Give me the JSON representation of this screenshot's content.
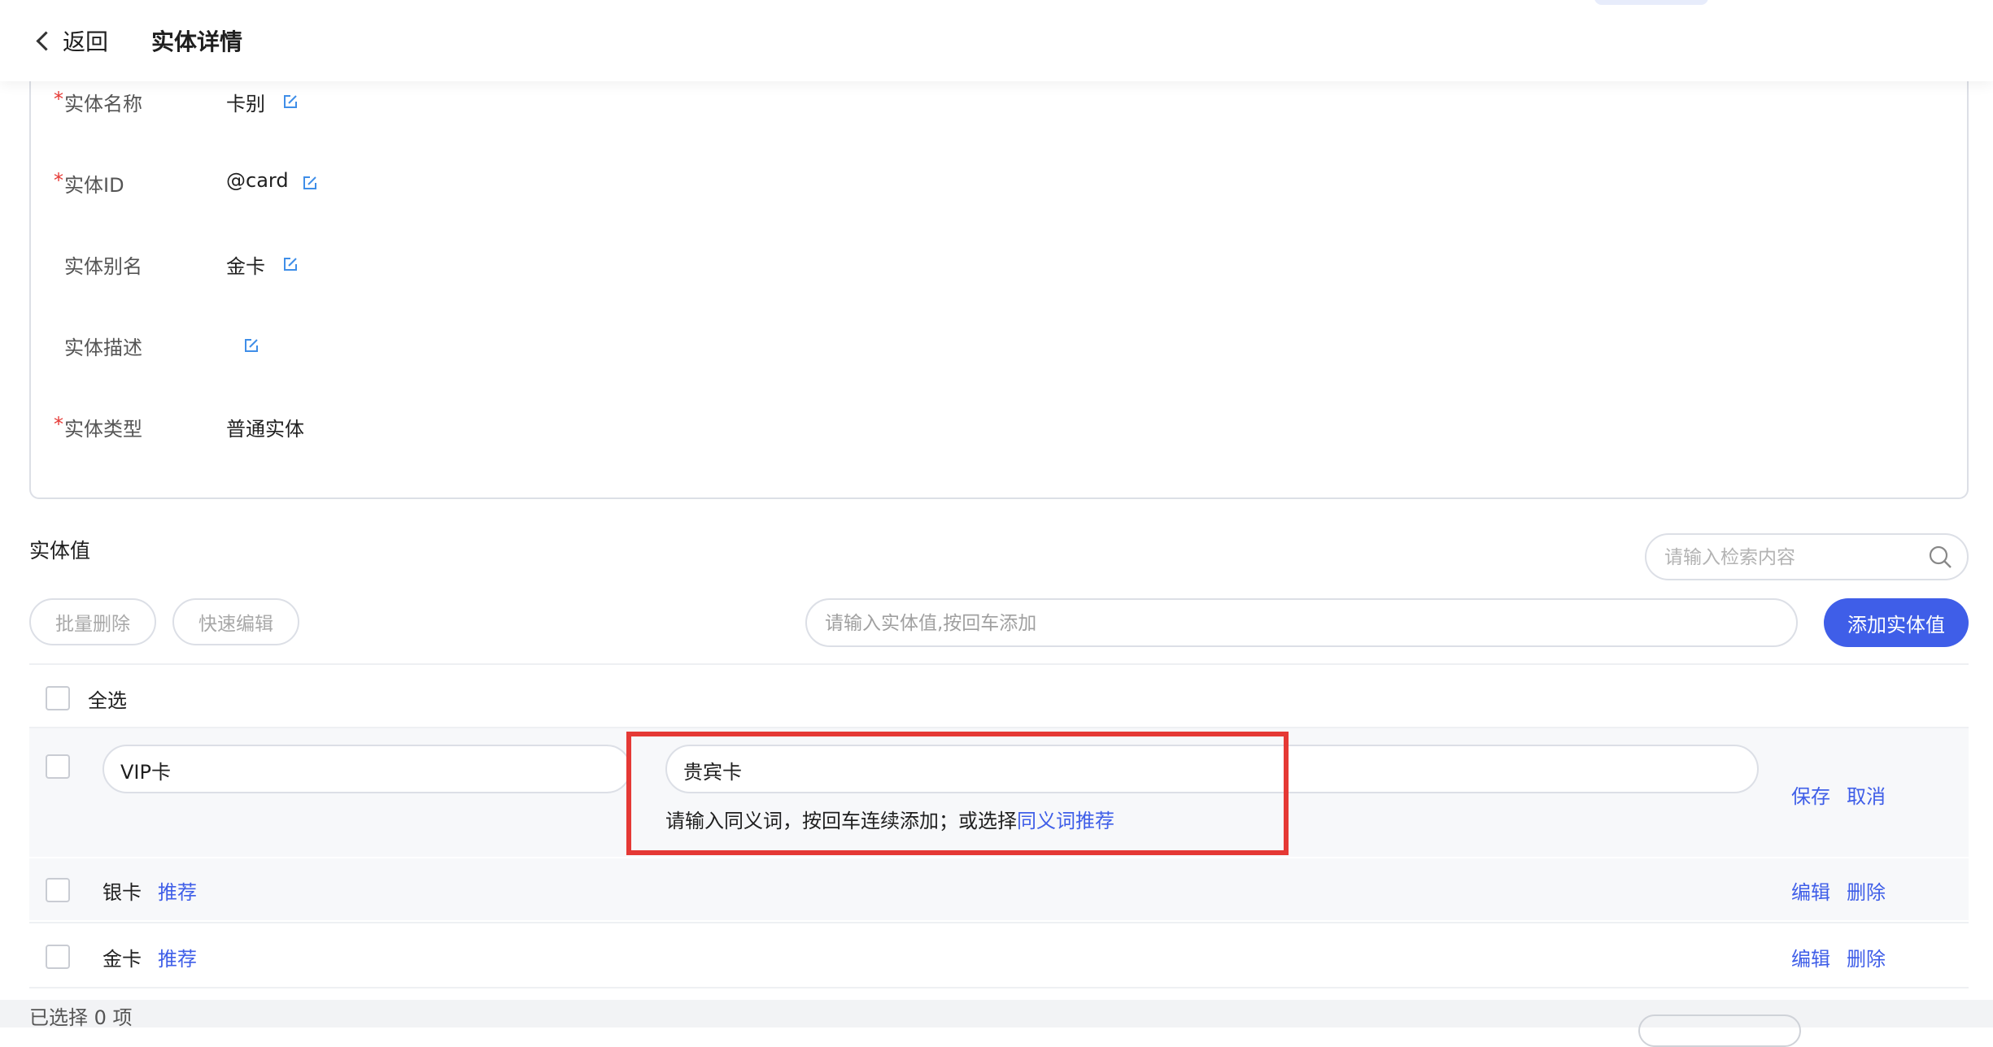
{
  "header": {
    "back_label": "返回",
    "title": "实体详情"
  },
  "info": {
    "name_label": "实体名称",
    "name_value": "卡别",
    "id_label": "实体ID",
    "id_value": "@card",
    "alias_label": "实体别名",
    "alias_value": "金卡",
    "desc_label": "实体描述",
    "desc_value": "",
    "type_label": "实体类型",
    "type_value": "普通实体",
    "required_mark": "*"
  },
  "values_section": {
    "title": "实体值",
    "search_placeholder": "请输入检索内容",
    "batch_delete": "批量删除",
    "quick_edit": "快速编辑",
    "add_placeholder": "请输入实体值,按回车添加",
    "add_button": "添加实体值",
    "select_all": "全选",
    "editing_row": {
      "value": "VIP卡",
      "synonym_value": "贵宾卡",
      "hint_text": "请输入同义词，按回车连续添加；或选择",
      "hint_link": "同义词推荐",
      "save": "保存",
      "cancel": "取消"
    },
    "rows": [
      {
        "value": "银卡",
        "tag": "推荐",
        "edit": "编辑",
        "delete": "删除"
      },
      {
        "value": "金卡",
        "tag": "推荐",
        "edit": "编辑",
        "delete": "删除"
      }
    ],
    "selected_count": "已选择 0 项"
  },
  "colors": {
    "accent": "#3f5ee8",
    "required": "#e53935",
    "highlight_box": "#e53935"
  },
  "icons": [
    "chevron-left-icon",
    "edit-icon",
    "search-icon"
  ]
}
